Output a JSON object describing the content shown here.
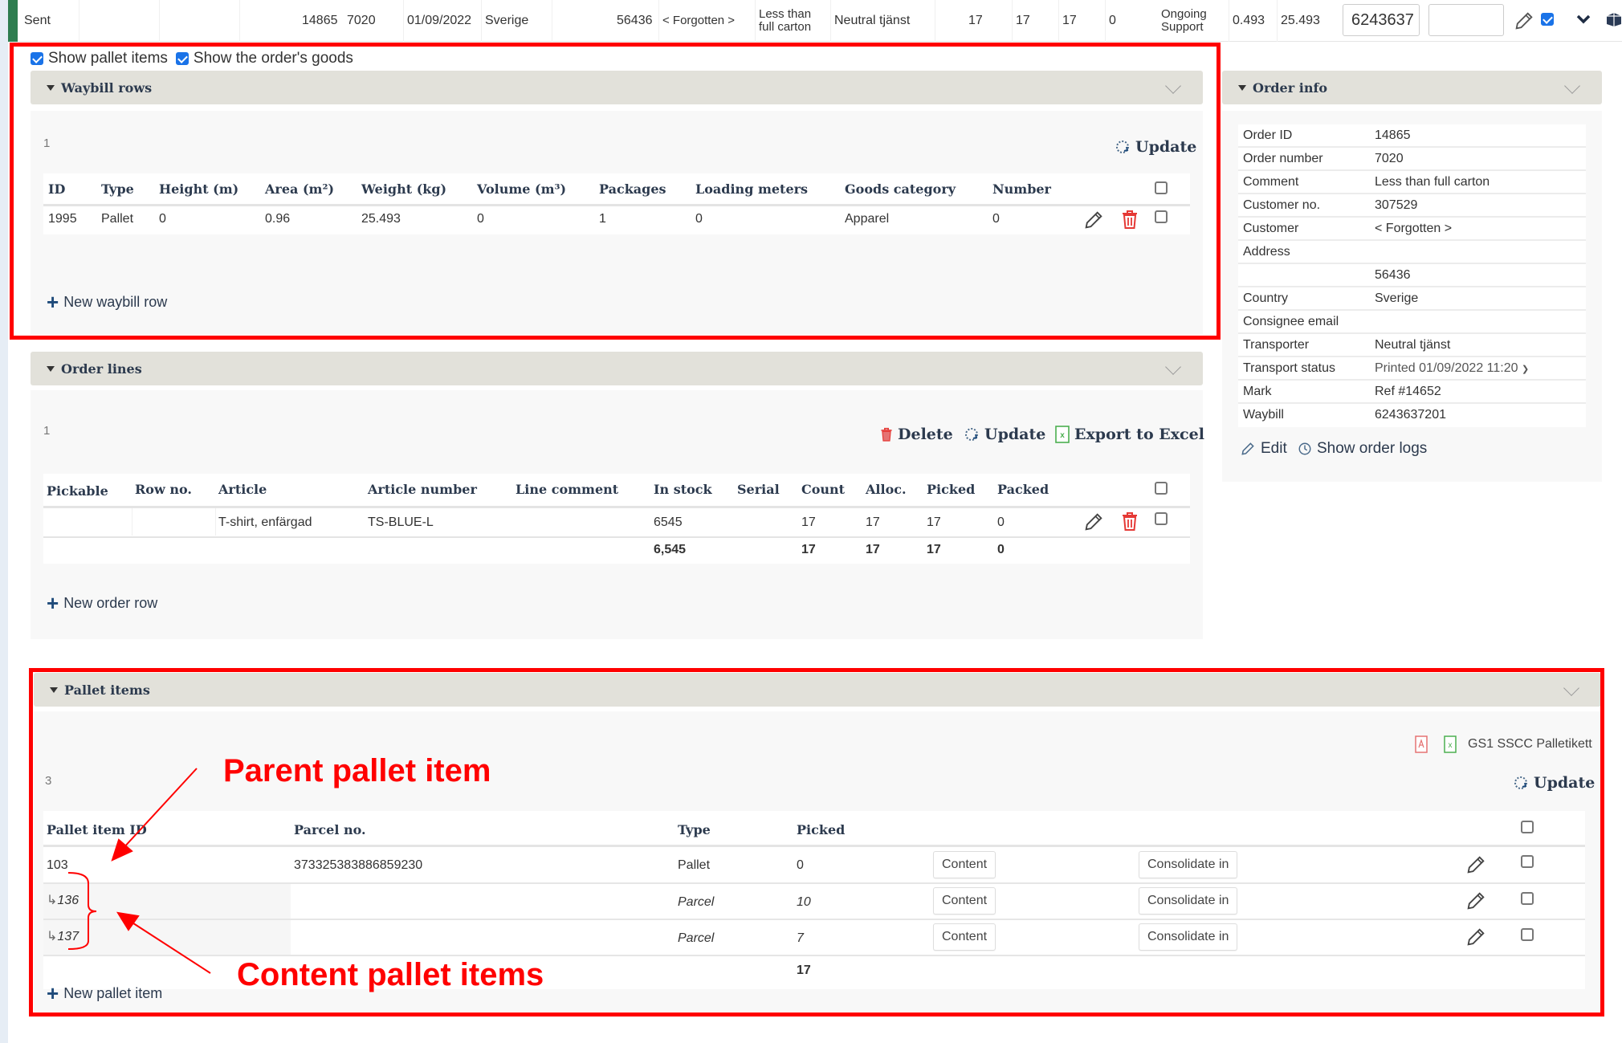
{
  "top_row": {
    "status": "Sent",
    "order_id": "14865",
    "order_number": "7020",
    "date": "01/09/2022",
    "country": "Sverige",
    "postcode": "56436",
    "customer": "< Forgotten >",
    "comment_line1": "Less than",
    "comment_line2": "full carton",
    "transporter": "Neutral tjänst",
    "count": "17",
    "alloc": "17",
    "picked": "17",
    "packed": "0",
    "warehouse_line1": "Ongoing",
    "warehouse_line2": "Support",
    "volume": "0.493",
    "weight": "25.493",
    "waybill_input": "6243637",
    "extra_input": "",
    "selected": true
  },
  "options": {
    "show_pallet_items_label": "Show pallet items",
    "show_pallet_items": true,
    "show_orders_goods_label": "Show the order's goods",
    "show_orders_goods": true
  },
  "waybill_rows": {
    "title": "Waybill rows",
    "count": "1",
    "update_label": "Update",
    "columns": [
      "ID",
      "Type",
      "Height (m)",
      "Area (m²)",
      "Weight (kg)",
      "Volume (m³)",
      "Packages",
      "Loading meters",
      "Goods category",
      "Number"
    ],
    "rows": [
      {
        "id": "1995",
        "type": "Pallet",
        "height": "0",
        "area": "0.96",
        "weight": "25.493",
        "volume": "0",
        "packages": "1",
        "loading_meters": "0",
        "goods_category": "Apparel",
        "number": "0"
      }
    ],
    "new_row_label": "New waybill row"
  },
  "order_lines": {
    "title": "Order lines",
    "count": "1",
    "delete_label": "Delete",
    "update_label": "Update",
    "export_label": "Export to Excel",
    "columns": [
      "Pickable",
      "Row no.",
      "Article",
      "Article number",
      "Line comment",
      "In stock",
      "Serial",
      "Count",
      "Alloc.",
      "Picked",
      "Packed"
    ],
    "rows": [
      {
        "pickable": "",
        "row_no": "",
        "article": "T-shirt, enfärgad",
        "article_number": "TS-BLUE-L",
        "line_comment": "",
        "in_stock": "6545",
        "serial": "",
        "count": "17",
        "alloc": "17",
        "picked": "17",
        "packed": "0"
      }
    ],
    "totals": {
      "in_stock": "6,545",
      "count": "17",
      "alloc": "17",
      "picked": "17",
      "packed": "0"
    },
    "new_row_label": "New order row"
  },
  "order_info": {
    "title": "Order info",
    "fields": [
      {
        "label": "Order ID",
        "value": "14865"
      },
      {
        "label": "Order number",
        "value": "7020"
      },
      {
        "label": "Comment",
        "value": "Less than full carton"
      },
      {
        "label": "Customer no.",
        "value": "307529"
      },
      {
        "label": "Customer",
        "value": "< Forgotten >"
      },
      {
        "label": "Address",
        "value": ""
      },
      {
        "label": "",
        "value": "56436"
      },
      {
        "label": "Country",
        "value": "Sverige"
      },
      {
        "label": "Consignee email",
        "value": ""
      },
      {
        "label": "Transporter",
        "value": "Neutral tjänst"
      },
      {
        "label": "Transport status",
        "value": "Printed 01/09/2022 11:20"
      },
      {
        "label": "Mark",
        "value": "Ref #14652"
      },
      {
        "label": "Waybill",
        "value": "6243637201"
      }
    ],
    "edit_label": "Edit",
    "logs_label": "Show order logs"
  },
  "pallet_items": {
    "title": "Pallet items",
    "count": "3",
    "label_report": "GS1 SSCC Palletikett",
    "update_label": "Update",
    "columns": [
      "Pallet item ID",
      "Parcel no.",
      "Type",
      "Picked"
    ],
    "rows": [
      {
        "id": "103",
        "parcel_no": "373325383886859230",
        "type": "Pallet",
        "picked": "0",
        "child": false
      },
      {
        "id": "136",
        "parcel_no": "",
        "type": "Parcel",
        "picked": "10",
        "child": true
      },
      {
        "id": "137",
        "parcel_no": "",
        "type": "Parcel",
        "picked": "7",
        "child": true
      }
    ],
    "content_label": "Content",
    "consolidate_label": "Consolidate in",
    "total_picked": "17",
    "new_row_label": "New pallet item"
  },
  "annotations": {
    "parent": "Parent pallet item",
    "content": "Content pallet items"
  },
  "colors": {
    "annotation_red": "#ff0000",
    "header_bar": "#e2e1da",
    "status_green": "#2e7d4f",
    "checkbox_blue": "#1a73e8",
    "delete_red": "#e53935"
  }
}
